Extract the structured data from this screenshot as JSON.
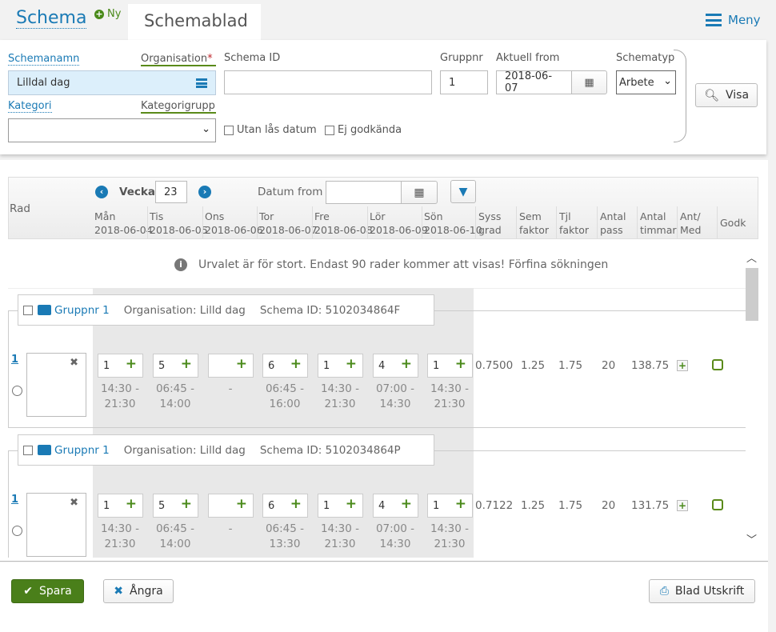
{
  "header": {
    "title": "Schema",
    "new_label": "Ny",
    "tab": "Schemablad",
    "menu": "Meny"
  },
  "filters": {
    "schemanamn_label": "Schemanamn",
    "organisation_label": "Organisation",
    "required_mark": "*",
    "organisation_value": "Lilldal dag",
    "schema_id_label": "Schema ID",
    "schema_id_value": "",
    "gruppnr_label": "Gruppnr",
    "gruppnr_value": "1",
    "aktuell_from_label": "Aktuell from",
    "aktuell_from_value": "2018-06-07",
    "schematyp_label": "Schematyp",
    "schematyp_value": "Arbete",
    "kategori_label": "Kategori",
    "kategorigrupp_label": "Kategorigrupp",
    "kategorigrupp_value": "",
    "utan_las_datum": "Utan lås datum",
    "ej_godkanda": "Ej godkända",
    "visa": "Visa"
  },
  "grid": {
    "rad_label": "Rad",
    "vecka_label": "Vecka",
    "vecka_value": "23",
    "datum_from_label": "Datum from",
    "datum_from_value": "",
    "days": [
      {
        "d": "Mån",
        "date": "2018-06-04"
      },
      {
        "d": "Tis",
        "date": "2018-06-05"
      },
      {
        "d": "Ons",
        "date": "2018-06-06"
      },
      {
        "d": "Tor",
        "date": "2018-06-07"
      },
      {
        "d": "Fre",
        "date": "2018-06-08"
      },
      {
        "d": "Lör",
        "date": "2018-06-09"
      },
      {
        "d": "Sön",
        "date": "2018-06-10"
      }
    ],
    "columns": [
      [
        "Syss",
        "grad"
      ],
      [
        "Sem",
        "faktor"
      ],
      [
        "Tjl",
        "faktor"
      ],
      [
        "Antal",
        "pass"
      ],
      [
        "Antal",
        "timmar"
      ],
      [
        "Ant/",
        "Med"
      ],
      [
        "Godk",
        ""
      ]
    ],
    "notice": "Urvalet är för stort. Endast 90 rader kommer att visas! Förfina sökningen",
    "rows": [
      {
        "group": "Gruppnr 1",
        "org": "Organisation: Lilld dag",
        "schema_id": "Schema ID: 5102034864F",
        "rad": "1",
        "cells": [
          {
            "v": "1",
            "t1": "14:30 -",
            "t2": "21:30"
          },
          {
            "v": "5",
            "t1": "06:45 -",
            "t2": "14:00"
          },
          {
            "v": "",
            "t1": "-",
            "t2": ""
          },
          {
            "v": "6",
            "t1": "06:45 -",
            "t2": "16:00"
          },
          {
            "v": "1",
            "t1": "14:30 -",
            "t2": "21:30"
          },
          {
            "v": "4",
            "t1": "07:00 -",
            "t2": "14:30"
          },
          {
            "v": "1",
            "t1": "14:30 -",
            "t2": "21:30"
          }
        ],
        "syss": "0.7500",
        "sem": "1.25",
        "tjl": "1.75",
        "pass": "20",
        "timmar": "138.75"
      },
      {
        "group": "Gruppnr 1",
        "org": "Organisation: Lilld dag",
        "schema_id": "Schema ID: 5102034864P",
        "rad": "1",
        "cells": [
          {
            "v": "1",
            "t1": "14:30 -",
            "t2": "21:30"
          },
          {
            "v": "5",
            "t1": "06:45 -",
            "t2": "14:00"
          },
          {
            "v": "",
            "t1": "-",
            "t2": ""
          },
          {
            "v": "6",
            "t1": "06:45 -",
            "t2": "13:30"
          },
          {
            "v": "1",
            "t1": "14:30 -",
            "t2": "21:30"
          },
          {
            "v": "4",
            "t1": "07:00 -",
            "t2": "14:30"
          },
          {
            "v": "1",
            "t1": "14:30 -",
            "t2": "21:30"
          }
        ],
        "syss": "0.7122",
        "sem": "1.25",
        "tjl": "1.75",
        "pass": "20",
        "timmar": "131.75"
      }
    ]
  },
  "footer": {
    "spara": "Spara",
    "angra": "Ångra",
    "utskrift": "Blad Utskrift"
  },
  "colors": {
    "accent": "#1a7ab5",
    "green": "#4a7f1a"
  }
}
